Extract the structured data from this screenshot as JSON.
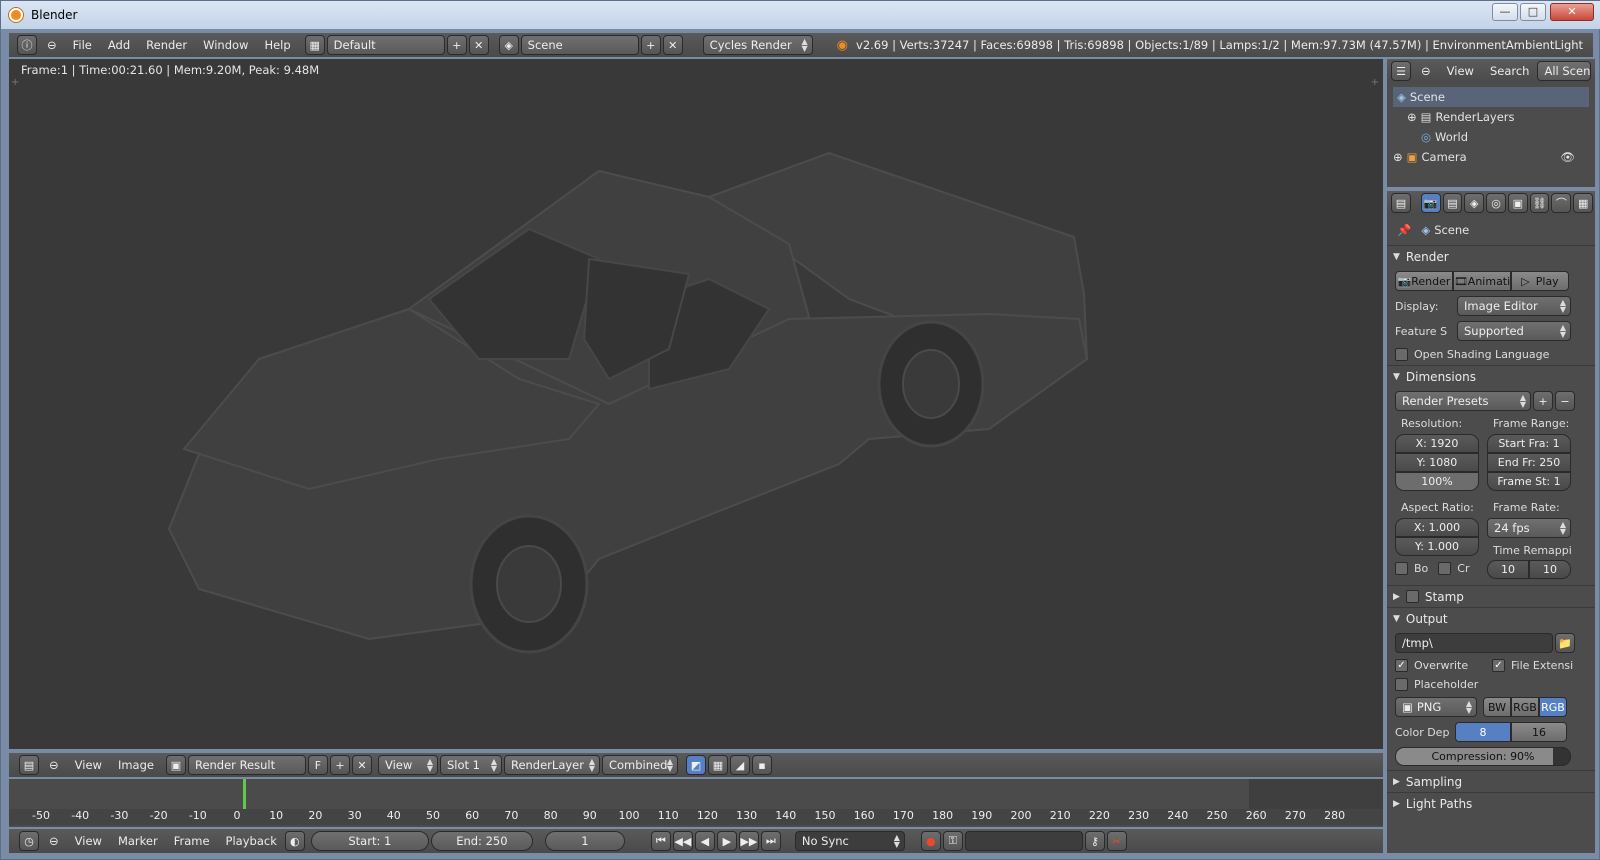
{
  "window": {
    "title": "Blender",
    "min": "—",
    "max": "□",
    "close": "✕"
  },
  "top": {
    "menus": [
      "File",
      "Add",
      "Render",
      "Window",
      "Help"
    ],
    "screen_layout": "Default",
    "scene": "Scene",
    "engine": "Cycles Render",
    "stats": "v2.69 | Verts:37247 | Faces:69898 | Tris:69898 | Objects:1/89 | Lamps:1/2 | Mem:97.73M (47.57M) | EnvironmentAmbientLight"
  },
  "viewport": {
    "frame_status": "Frame:1 | Time:00:21.60 | Mem:9.20M, Peak: 9.48M"
  },
  "image_editor_header": {
    "view": "View",
    "image": "Image",
    "image_name": "Render Result",
    "fake_user": "F",
    "view_dropdown": "View",
    "slot": "Slot 1",
    "render_layer": "RenderLayer",
    "pass": "Combined"
  },
  "timeline": {
    "ruler": [
      "-50",
      "-40",
      "-30",
      "-20",
      "-10",
      "0",
      "10",
      "20",
      "30",
      "40",
      "50",
      "60",
      "70",
      "80",
      "90",
      "100",
      "110",
      "120",
      "130",
      "140",
      "150",
      "160",
      "170",
      "180",
      "190",
      "200",
      "210",
      "220",
      "230",
      "240",
      "250",
      "260",
      "270",
      "280"
    ],
    "menus": [
      "View",
      "Marker",
      "Frame",
      "Playback"
    ],
    "start": "Start: 1",
    "end": "End: 250",
    "current": "1",
    "sync": "No Sync",
    "current_frame": 0
  },
  "outliner": {
    "menus": [
      "View",
      "Search"
    ],
    "filter": "All Scene",
    "items": [
      "Scene",
      "RenderLayers",
      "World",
      "Camera"
    ]
  },
  "properties": {
    "context": "Scene",
    "render": {
      "title": "Render",
      "render_btn": "Render",
      "anim_btn": "Animati",
      "play_btn": "Play",
      "display_label": "Display:",
      "display_value": "Image Editor",
      "feature_label": "Feature S",
      "feature_value": "Supported",
      "osl": "Open Shading Language"
    },
    "dimensions": {
      "title": "Dimensions",
      "presets": "Render Presets",
      "resolution_label": "Resolution:",
      "res_x": "X: 1920",
      "res_y": "Y: 1080",
      "res_pct": "100%",
      "frame_range_label": "Frame Range:",
      "start_frame": "Start Fra: 1",
      "end_frame": "End Fr: 250",
      "frame_step": "Frame St: 1",
      "aspect_label": "Aspect Ratio:",
      "asp_x": "X: 1.000",
      "asp_y": "Y: 1.000",
      "frame_rate_label": "Frame Rate:",
      "fps": "24 fps",
      "time_remap_label": "Time Remappi",
      "remap_old": "10",
      "remap_new": "10",
      "border": "Bo",
      "crop": "Cr"
    },
    "stamp": {
      "title": "Stamp"
    },
    "output": {
      "title": "Output",
      "path": "/tmp\\",
      "overwrite": "Overwrite",
      "file_ext": "File Extensi",
      "placeholder": "Placeholder",
      "format": "PNG",
      "bw": "BW",
      "rgb": "RGB",
      "rgba": "RGB",
      "color_depth_label": "Color Dep",
      "depth_8": "8",
      "depth_16": "16",
      "compression": "Compression: 90%",
      "compression_value": 0.9
    },
    "sampling": {
      "title": "Sampling"
    },
    "next": {
      "title": "Light Paths"
    }
  }
}
